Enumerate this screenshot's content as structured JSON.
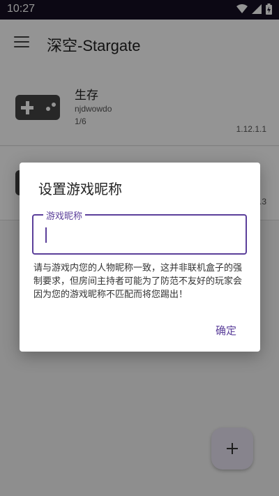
{
  "status_bar": {
    "time": "10:27",
    "icons": [
      "wifi-icon",
      "cell-signal-icon",
      "battery-charging-icon"
    ]
  },
  "app_bar": {
    "title": "深空-Stargate",
    "menu_icon": "menu-icon"
  },
  "cards": [
    {
      "title": "生存",
      "user": "njdwowdo",
      "count": "1/6",
      "version": "1.12.1.1",
      "icon": "gamepad-icon"
    },
    {
      "version_partial": ".3",
      "icon": "gamepad-icon"
    }
  ],
  "dialog": {
    "title": "设置游戏昵称",
    "field_label": "游戏昵称",
    "field_value": "",
    "message": "请与游戏内您的人物昵称一致，这并非联机盒子的强制要求，但房间主持者可能为了防范不友好的玩家会因为您的游戏昵称不匹配而将您踢出！",
    "confirm_label": "确定"
  },
  "fab": {
    "icon": "plus-icon"
  },
  "colors": {
    "accent": "#5b3f9a",
    "status_bar": "#150f23",
    "scrim": "rgba(0,0,0,0.42)"
  }
}
